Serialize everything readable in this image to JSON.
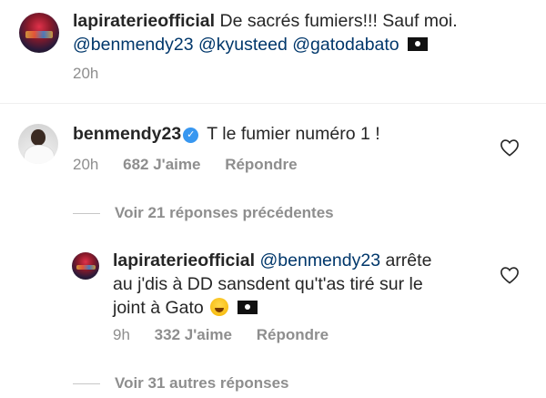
{
  "comments": [
    {
      "username": "lapiraterieofficial",
      "text_line1": "De sacrés fumiers!!! Sauf moi.",
      "mentions": [
        "@benmendy23",
        "@kyusteed",
        "@gatodabato"
      ],
      "time": "20h"
    },
    {
      "username": "benmendy23",
      "text": "T le fumier numéro 1 !",
      "time": "20h",
      "likes": "682 J'aime",
      "reply_label": "Répondre"
    }
  ],
  "view_previous": "Voir 21 réponses précédentes",
  "reply": {
    "username": "lapiraterieofficial",
    "mention": "@benmendy23",
    "text_line1_rest": "arrête",
    "text_line2": "au j'dis à DD sansdent qu't'as tiré sur le",
    "text_line3": "joint à Gato",
    "time": "9h",
    "likes": "332 J'aime",
    "reply_label": "Répondre"
  },
  "view_more": "Voir 31 autres réponses",
  "icons": {
    "heart": "heart-icon",
    "verified": "verified-badge-icon",
    "flag": "pirate-flag-emoji",
    "laugh": "laughing-emoji"
  }
}
